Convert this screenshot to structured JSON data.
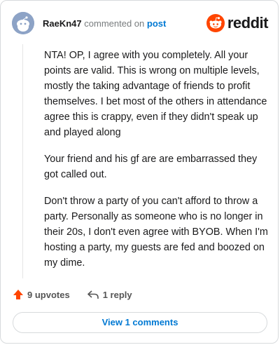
{
  "header": {
    "username": "RaeKn47",
    "action": "commented on",
    "post_link": "post",
    "logo_text": "reddit"
  },
  "comment": {
    "paragraphs": [
      "NTA! OP, I agree with you completely. All your points are valid. This is wrong on multiple levels, mostly the taking advantage of friends to profit themselves. I bet most of the others in attendance agree this is crappy, even if they didn't speak up and played along",
      "Your friend and his gf are are embarrassed they got called out.",
      "Don't throw a party of you can't afford to throw a party. Personally as someone who is no longer in their 20s, I don't even agree with BYOB. When I'm hosting a party, my guests are fed and boozed on my dime."
    ]
  },
  "footer": {
    "upvotes_label": "9 upvotes",
    "reply_label": "1 reply",
    "view_comments_label": "View 1 comments"
  },
  "colors": {
    "accent": "#0079d3",
    "upvote": "#ff4500"
  },
  "icons": [
    "avatar-snoo",
    "reddit-logo-icon",
    "upvote-arrow-icon",
    "reply-arrow-icon"
  ]
}
